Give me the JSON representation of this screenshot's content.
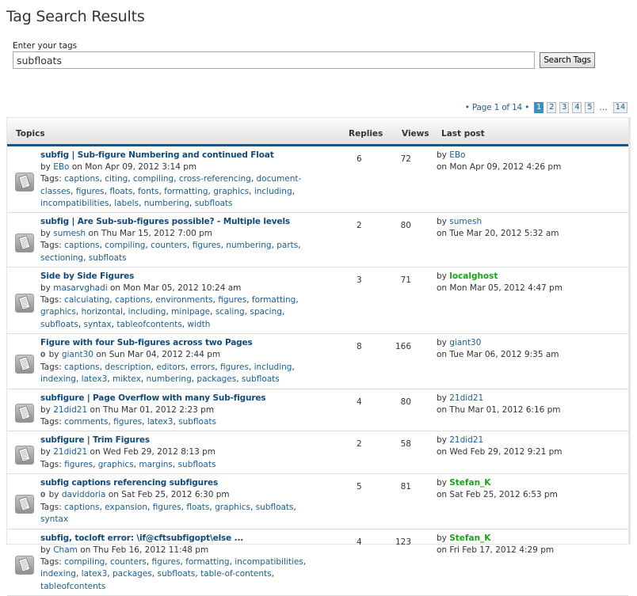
{
  "page": {
    "title": "Tag Search Results"
  },
  "search": {
    "label": "Enter your tags",
    "value": "subfloats",
    "button_label": "Search Tags"
  },
  "pagination": {
    "info": "• Page 1 of 14 •",
    "pages": [
      "1",
      "2",
      "3",
      "4",
      "5"
    ],
    "active": "1",
    "ellipsis": "…",
    "last": "14"
  },
  "table": {
    "headers": {
      "topics": "Topics",
      "replies": "Replies",
      "views": "Views",
      "last_post": "Last post"
    },
    "rows": [
      {
        "title": "subfig | Sub-figure Numbering and continued Float",
        "attachment": false,
        "by_prefix": "by",
        "author": "EBo",
        "date_text": "on Mon Apr 09, 2012 3:14 pm",
        "tags_label": "Tags:",
        "tags": [
          "captions",
          "citing",
          "compiling",
          "cross-referencing",
          "document-classes",
          "figures",
          "floats",
          "fonts",
          "formatting",
          "graphics",
          "including",
          "incompatibilities",
          "labels",
          "numbering",
          "subfloats"
        ],
        "replies": "6",
        "views": "72",
        "last_by": "by",
        "last_author": "EBo",
        "last_author_special": false,
        "last_date": "on Mon Apr 09, 2012 4:26 pm"
      },
      {
        "title": "subfig | Are Sub-sub-figures possible? - Multiple levels",
        "attachment": false,
        "by_prefix": "by",
        "author": "sumesh",
        "date_text": "on Thu Mar 15, 2012 7:00 pm",
        "tags_label": "Tags:",
        "tags": [
          "captions",
          "compiling",
          "counters",
          "figures",
          "numbering",
          "parts",
          "sectioning",
          "subfloats"
        ],
        "replies": "2",
        "views": "80",
        "last_by": "by",
        "last_author": "sumesh",
        "last_author_special": false,
        "last_date": "on Tue Mar 20, 2012 5:32 am"
      },
      {
        "title": "Side by Side Figures",
        "attachment": false,
        "by_prefix": "by",
        "author": "masarvghadi",
        "date_text": "on Mon Mar 05, 2012 10:24 am",
        "tags_label": "Tags:",
        "tags": [
          "calculating",
          "captions",
          "environments",
          "figures",
          "formatting",
          "graphics",
          "horizontal",
          "including",
          "minipage",
          "scaling",
          "spacing",
          "subfloats",
          "syntax",
          "tableofcontents",
          "width"
        ],
        "replies": "3",
        "views": "71",
        "last_by": "by",
        "last_author": "localghost",
        "last_author_special": true,
        "last_date": "on Mon Mar 05, 2012 4:47 pm"
      },
      {
        "title": "Figure with four Sub-figures across two Pages",
        "attachment": true,
        "by_prefix": "by",
        "author": "giant30",
        "date_text": "on Sun Mar 04, 2012 2:44 pm",
        "tags_label": "Tags:",
        "tags": [
          "captions",
          "description",
          "editors",
          "errors",
          "figures",
          "including",
          "indexing",
          "latex3",
          "miktex",
          "numbering",
          "packages",
          "subfloats"
        ],
        "replies": "8",
        "views": "166",
        "last_by": "by",
        "last_author": "giant30",
        "last_author_special": false,
        "last_date": "on Tue Mar 06, 2012 9:35 am"
      },
      {
        "title": "subfigure | Page Overflow with many Sub-figures",
        "attachment": false,
        "by_prefix": "by",
        "author": "21did21",
        "date_text": "on Thu Mar 01, 2012 2:23 pm",
        "tags_label": "Tags:",
        "tags": [
          "comments",
          "figures",
          "latex3",
          "subfloats"
        ],
        "replies": "4",
        "views": "80",
        "last_by": "by",
        "last_author": "21did21",
        "last_author_special": false,
        "last_date": "on Thu Mar 01, 2012 6:16 pm"
      },
      {
        "title": "subfigure | Trim Figures",
        "attachment": false,
        "by_prefix": "by",
        "author": "21did21",
        "date_text": "on Wed Feb 29, 2012 8:13 pm",
        "tags_label": "Tags:",
        "tags": [
          "figures",
          "graphics",
          "margins",
          "subfloats"
        ],
        "replies": "2",
        "views": "58",
        "last_by": "by",
        "last_author": "21did21",
        "last_author_special": false,
        "last_date": "on Wed Feb 29, 2012 9:21 pm"
      },
      {
        "title": "subfig captions referencing subfigures",
        "attachment": true,
        "by_prefix": "by",
        "author": "daviddoria",
        "date_text": "on Sat Feb 25, 2012 6:30 pm",
        "tags_label": "Tags:",
        "tags": [
          "captions",
          "expansion",
          "figures",
          "floats",
          "graphics",
          "subfloats",
          "syntax"
        ],
        "replies": "5",
        "views": "81",
        "last_by": "by",
        "last_author": "Stefan_K",
        "last_author_special": true,
        "last_date": "on Sat Feb 25, 2012 6:53 pm"
      },
      {
        "title": "subfig, tocloft error: \\if@cftsubfigopt\\else ...",
        "attachment": false,
        "by_prefix": "by",
        "author": "Cham",
        "date_text": "on Thu Feb 16, 2012 11:48 pm",
        "tags_label": "Tags:",
        "tags": [
          "compiling",
          "counters",
          "figures",
          "formatting",
          "incompatibilities",
          "indexing",
          "latex3",
          "packages",
          "subfloats",
          "table-of-contents",
          "tableofcontents"
        ],
        "replies": "4",
        "views": "123",
        "last_by": "by",
        "last_author": "Stefan_K",
        "last_author_special": true,
        "last_date": "on Fri Feb 17, 2012 4:29 pm"
      }
    ]
  },
  "colors": {
    "link": "#1a5d93",
    "title_link": "#124a7a",
    "special_user": "#19a319",
    "header_rule": "#1c5380",
    "active_page": "#3f8fbd"
  }
}
